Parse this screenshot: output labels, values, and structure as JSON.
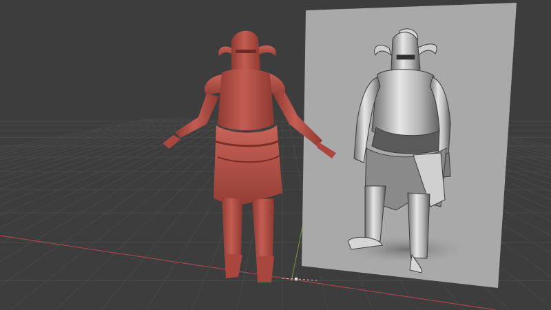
{
  "viewport": {
    "background": "#3d3d3d",
    "grid_color": "#474747",
    "x_axis_color": "#a5464f",
    "y_axis_color": "#6d8a3a"
  },
  "objects": [
    {
      "name": "armored-knight-sculpt",
      "material_color": "#b9534a"
    },
    {
      "name": "reference-image-plane",
      "description_icon": "knight-sketch"
    }
  ]
}
